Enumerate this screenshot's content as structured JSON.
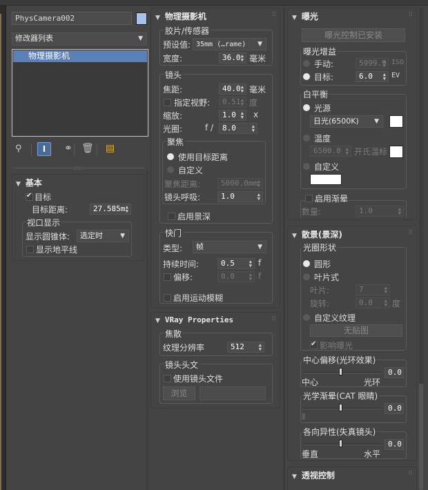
{
  "object": {
    "name": "PhysCamera002",
    "color": "#a9c0e8",
    "modifier_list": "修改器列表",
    "stack_items": [
      "物理摄影机"
    ]
  },
  "toolbar_icons": [
    "pin-stack-icon",
    "show-end-result-icon",
    "make-unique-icon",
    "remove-modifier-icon",
    "configure-modifier-sets-icon"
  ],
  "basic": {
    "title": "基本",
    "target_label": "目标",
    "target_checked": true,
    "target_distance_label": "目标距离:",
    "target_distance": "27.585m",
    "viewport_display_title": "视口显示",
    "show_cone_label": "显示圆锥体:",
    "show_cone_value": "选定时",
    "show_horizon_label": "显示地平线",
    "show_horizon_checked": false
  },
  "physical_camera": {
    "title": "物理摄影机",
    "film_title": "胶片/传感器",
    "preset_label": "预设值:",
    "preset_value": "35mm (…rame)",
    "width_label": "宽度:",
    "width_value": "36.0",
    "width_unit": "毫米",
    "lens_title": "镜头",
    "focal_label": "焦距:",
    "focal_value": "40.0",
    "focal_unit": "毫米",
    "fov_label": "指定视野:",
    "fov_value": "0.51",
    "fov_unit": "度",
    "zoom_label": "缩放:",
    "zoom_value": "1.0",
    "zoom_unit": "x",
    "aperture_label": "光圈:",
    "aperture_prefix": "f /",
    "aperture_value": "8.0",
    "focus_title": "聚焦",
    "use_target_label": "使用目标距离",
    "custom_label": "自定义",
    "focus_distance_label": "聚焦距离:",
    "focus_distance_value": "5000.0mm",
    "breathing_label": "镜头呼吸:",
    "breathing_value": "1.0",
    "enable_dof_label": "启用景深",
    "shutter_title": "快门",
    "type_label": "类型:",
    "type_value": "帧",
    "duration_label": "持续时间:",
    "duration_value": "0.5",
    "duration_unit": "f",
    "offset_label": "偏移:",
    "offset_value": "0.0",
    "offset_unit": "f",
    "motion_blur_label": "启用运动模糊"
  },
  "vray": {
    "title": "VRay Properties",
    "caustics_title": "焦散",
    "texture_res_label": "纹理分辨率",
    "texture_res_value": "512",
    "lens_file_title": "镜头头文",
    "use_lens_file_label": "使用镜头文件",
    "browse_label": "浏览"
  },
  "exposure": {
    "title": "曝光",
    "install_button": "曝光控制已安装",
    "gain_title": "曝光增益",
    "manual_label": "手动:",
    "manual_value": "5999.9",
    "manual_unit": "ISO",
    "target_label": "目标:",
    "target_value": "6.0",
    "target_unit": "EV",
    "wb_title": "白平衡",
    "illuminant_label": "光源",
    "illuminant_value": "日光(6500K)",
    "temperature_label": "温度",
    "temperature_value": "6500.0",
    "temperature_unit": "开氏温标",
    "custom_label": "自定义",
    "vignette_label": "启用渐晕",
    "amount_label": "数量:",
    "amount_value": "1.0"
  },
  "bokeh": {
    "title": "散景(景深)",
    "aperture_shape_title": "光圈形状",
    "circular_label": "圆形",
    "bladed_label": "叶片式",
    "blades_label": "叶片:",
    "blades_value": "7",
    "rotation_label": "旋转:",
    "rotation_value": "0.0",
    "rotation_unit": "度",
    "custom_texture_label": "自定义纹理",
    "no_map_label": "无贴图",
    "affect_exposure_label": "影响曝光",
    "center_bias_title": "中心偏移(光环效果)",
    "center_label": "中心",
    "ring_label": "光环",
    "center_bias_value": "0.0",
    "optical_vignetting_title": "光学渐晕(CAT 眼睛)",
    "optical_vignetting_value": "0.0",
    "anisotropy_title": "各向异性(失真镜头)",
    "vertical_label": "垂直",
    "horizontal_label": "水平",
    "anisotropy_value": "0.0"
  },
  "perspective": {
    "title": "透视控制"
  }
}
